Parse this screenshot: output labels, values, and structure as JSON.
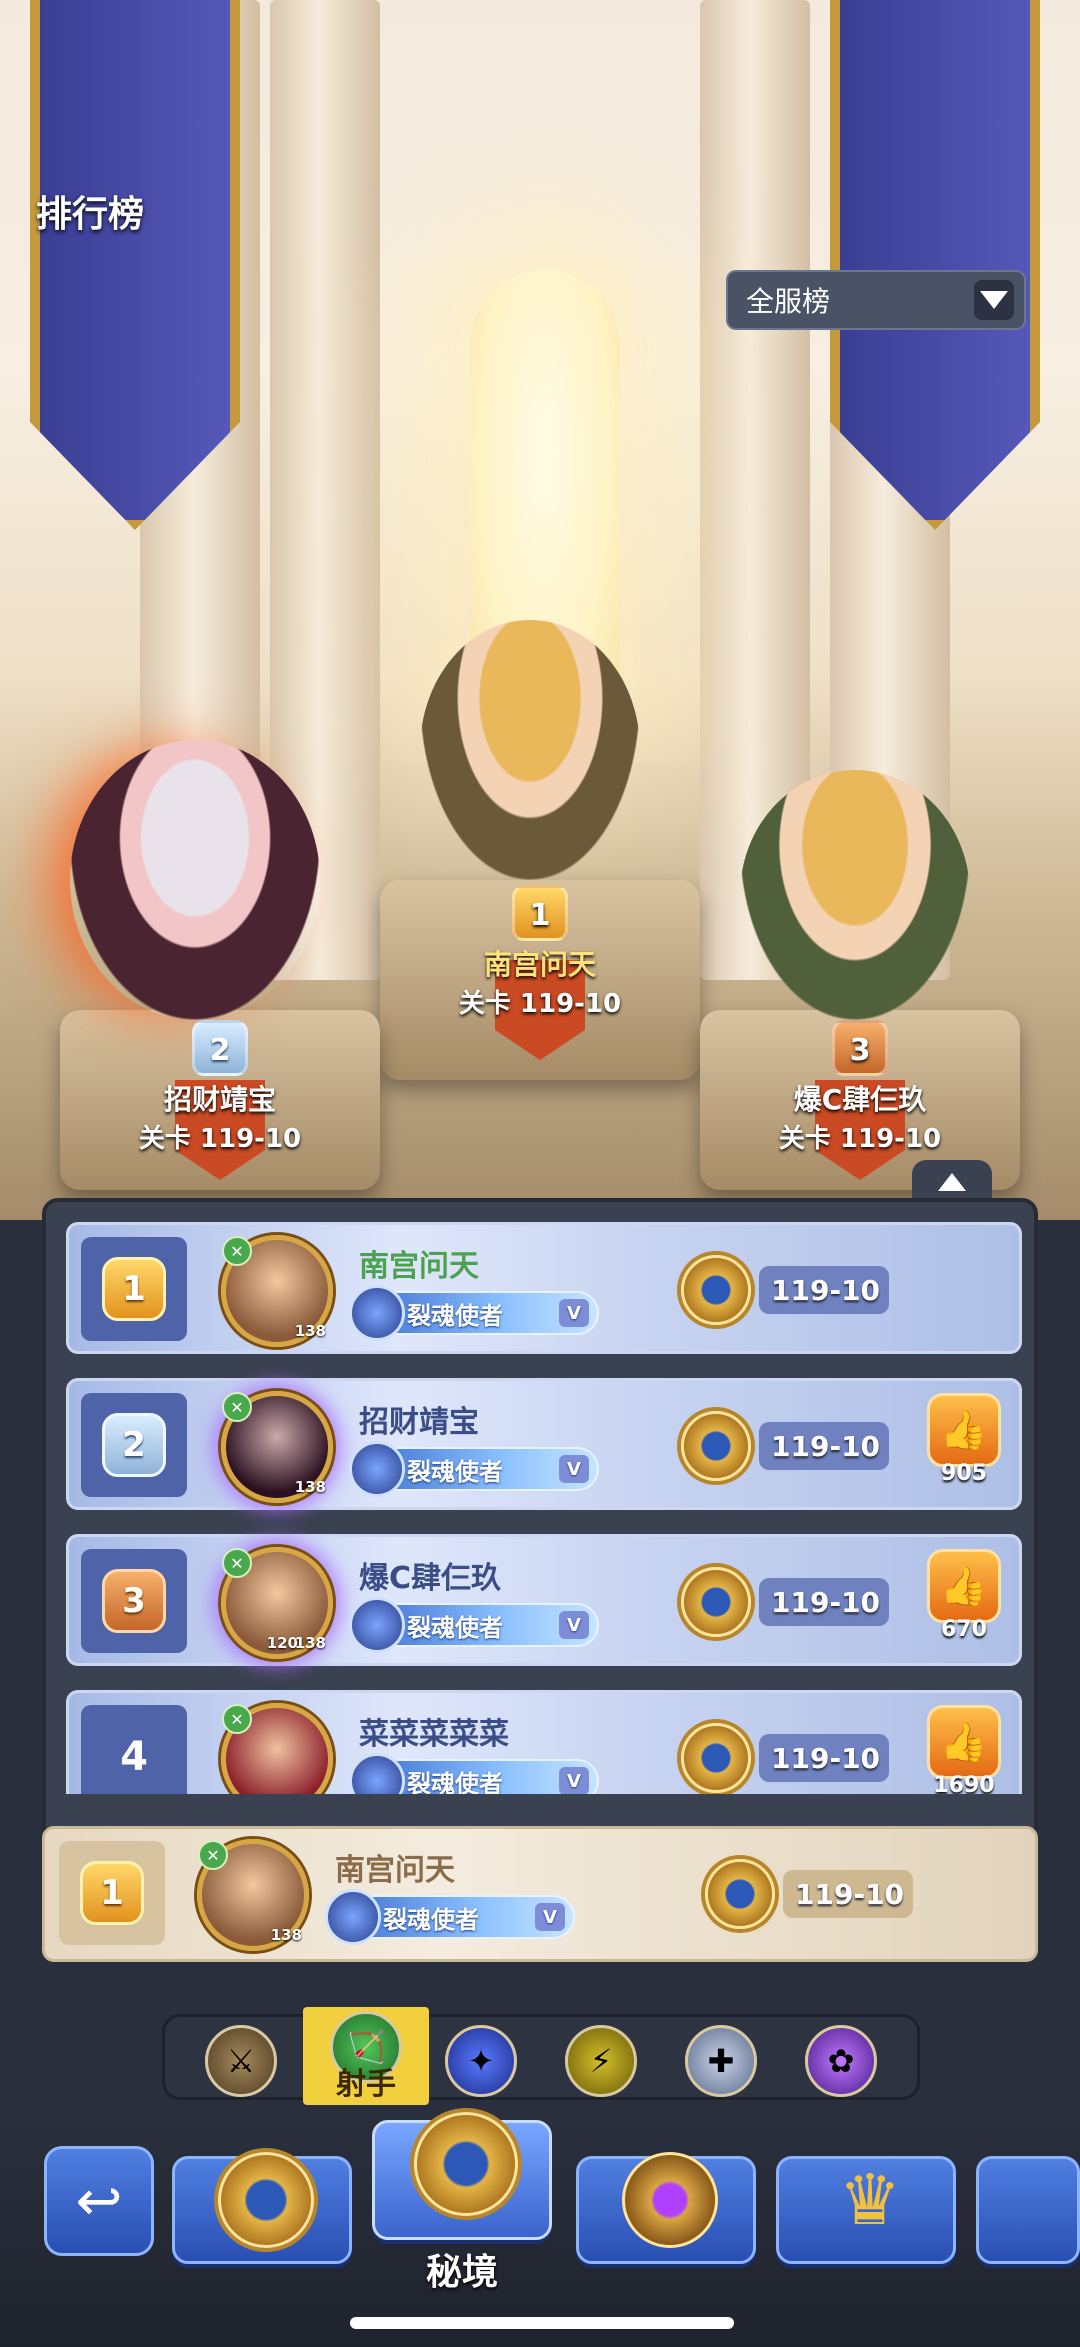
{
  "header": {
    "title": "排行榜"
  },
  "scope_select": {
    "value": "全服榜"
  },
  "podium": [
    {
      "rank": "1",
      "name": "南宫问天",
      "stage": "关卡 119-10"
    },
    {
      "rank": "2",
      "name": "招财靖宝",
      "stage": "关卡 119-10"
    },
    {
      "rank": "3",
      "name": "爆C肆仨玖",
      "stage": "关卡 119-10"
    }
  ],
  "leaderboard": {
    "rows": [
      {
        "rank": "1",
        "name": "南宫问天",
        "level": "138",
        "title": "裂魂使者",
        "vip": "V",
        "stage": "119-10",
        "likes": ""
      },
      {
        "rank": "2",
        "name": "招财靖宝",
        "level": "138",
        "title": "裂魂使者",
        "vip": "V",
        "stage": "119-10",
        "likes": "905"
      },
      {
        "rank": "3",
        "name": "爆C肆仨玖",
        "level": "138",
        "level2": "120",
        "title": "裂魂使者",
        "vip": "V",
        "stage": "119-10",
        "likes": "670"
      },
      {
        "rank": "4",
        "name": "菜菜菜菜菜",
        "level": "",
        "title": "裂魂使者",
        "vip": "V",
        "stage": "119-10",
        "likes": "1690"
      }
    ]
  },
  "my_rank": {
    "rank": "1",
    "name": "南宫问天",
    "level": "138",
    "title": "裂魂使者",
    "vip": "V",
    "stage": "119-10"
  },
  "class_filter": {
    "active_label": "射手",
    "items": [
      "warrior-class",
      "archer-class",
      "mage-class",
      "assassin-class",
      "priest-class",
      "summoner-class"
    ]
  },
  "bottom_nav": {
    "active_label": "秘境",
    "items": [
      "back",
      "stage-ranking",
      "secret-realm",
      "eye-emblem",
      "crown-emblem",
      "more"
    ]
  },
  "colors": {
    "accent_gold": "#f2cf3c",
    "panel": "#3a4150",
    "row_blue": "#c8d4f1",
    "name_green": "#4aa24e"
  }
}
